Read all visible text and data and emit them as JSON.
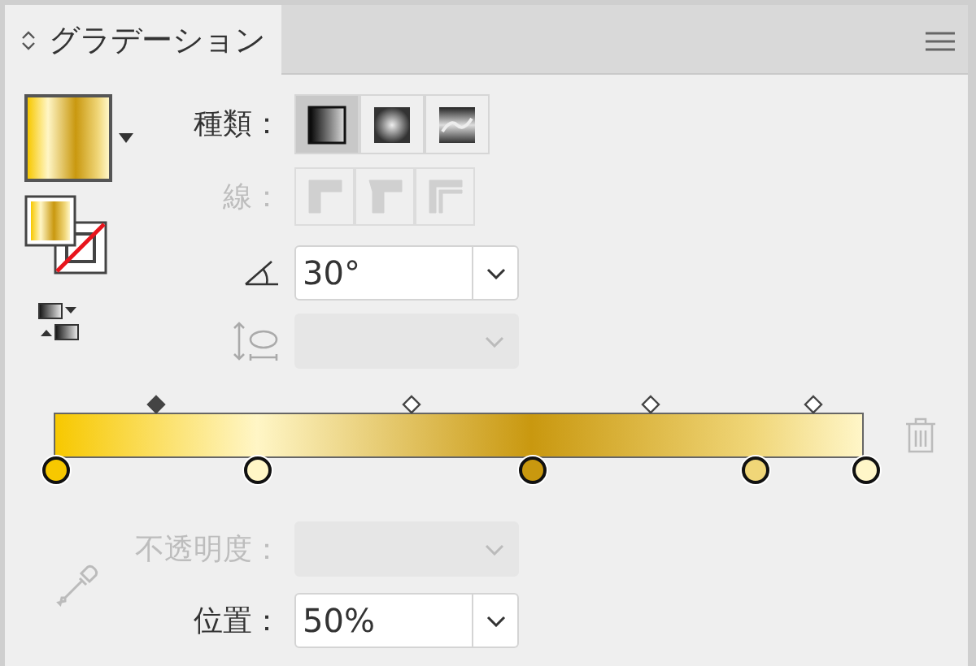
{
  "panel": {
    "title": "グラデーション"
  },
  "gradient_types": [
    {
      "kind": "linear",
      "selected": true
    },
    {
      "kind": "radial",
      "selected": false
    },
    {
      "kind": "freeform",
      "selected": false
    }
  ],
  "type_label": "種類：",
  "stroke_label": "線：",
  "stroke_buttons": [
    {
      "kind": "within",
      "disabled": true
    },
    {
      "kind": "along",
      "disabled": true
    },
    {
      "kind": "across",
      "disabled": true
    }
  ],
  "angle": {
    "value": "30°"
  },
  "aspect_ratio": {
    "disabled": true
  },
  "stops": [
    {
      "color": "#f7c800",
      "level": 0,
      "selected": false
    },
    {
      "color": "#fff6c6",
      "level": 0.25,
      "selected": false
    },
    {
      "color": "#c9980f",
      "level": 0.59,
      "selected": false
    },
    {
      "color": "#f0d678",
      "level": 0.865,
      "selected": false
    },
    {
      "color": "#fff6c8",
      "level": 1,
      "selected": false
    }
  ],
  "midpoints": [
    {
      "level": 0.125,
      "selected": true
    },
    {
      "level": 0.44,
      "selected": false
    },
    {
      "level": 0.735,
      "selected": false
    },
    {
      "level": 0.935,
      "selected": false
    }
  ],
  "opacity": {
    "label": "不透明度：",
    "disabled": true
  },
  "location": {
    "label": "位置：",
    "value": "50%"
  }
}
